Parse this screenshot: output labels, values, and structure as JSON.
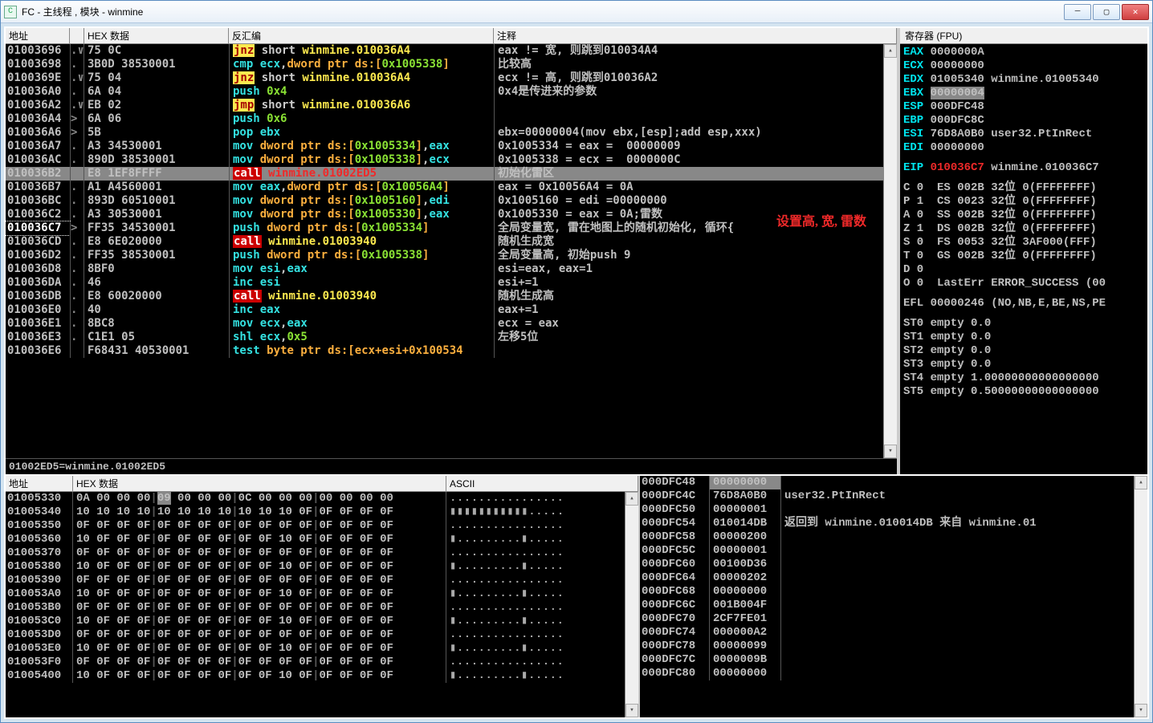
{
  "window": {
    "title": "FC - 主线程 , 模块 - winmine",
    "icon_letter": "C"
  },
  "disasm_headers": {
    "addr": "地址",
    "hex": "HEX 数据",
    "dis": "反汇编",
    "cmt": "注释"
  },
  "info_line": "01002ED5=winmine.01002ED5",
  "disasm": [
    {
      "addr": "01003696",
      "pre": ".∨",
      "hex": "75 0C",
      "m": "jnz",
      "mc": "jmp",
      "ops": [
        {
          "t": " short "
        },
        {
          "t": "winmine.010036A4",
          "c": "tgt"
        }
      ],
      "cmt": "eax != 宽, 则跳到010034A4"
    },
    {
      "addr": "01003698",
      "pre": ".",
      "hex": "3B0D 38530001",
      "m": "cmp",
      "mc": "",
      "ops": [
        {
          "t": " "
        },
        {
          "t": "ecx",
          "c": "reg"
        },
        {
          "t": ","
        },
        {
          "t": "dword ptr ds:[",
          "c": "mem"
        },
        {
          "t": "0x1005338",
          "c": "num"
        },
        {
          "t": "]",
          "c": "mem"
        }
      ],
      "cmt": "比较高"
    },
    {
      "addr": "0100369E",
      "pre": ".∨",
      "hex": "75 04",
      "m": "jnz",
      "mc": "jmp",
      "ops": [
        {
          "t": " short "
        },
        {
          "t": "winmine.010036A4",
          "c": "tgt"
        }
      ],
      "cmt": "ecx != 高, 则跳到010036A2"
    },
    {
      "addr": "010036A0",
      "pre": ".",
      "hex": "6A 04",
      "m": "push",
      "mc": "",
      "ops": [
        {
          "t": " "
        },
        {
          "t": "0x4",
          "c": "num"
        }
      ],
      "cmt": "0x4是传进来的参数"
    },
    {
      "addr": "010036A2",
      "pre": ".∨",
      "hex": "EB 02",
      "m": "jmp",
      "mc": "jmp",
      "ops": [
        {
          "t": " short "
        },
        {
          "t": "winmine.010036A6",
          "c": "tgt"
        }
      ],
      "cmt": ""
    },
    {
      "addr": "010036A4",
      "pre": ">",
      "hex": "6A 06",
      "m": "push",
      "mc": "",
      "ops": [
        {
          "t": " "
        },
        {
          "t": "0x6",
          "c": "num"
        }
      ],
      "cmt": ""
    },
    {
      "addr": "010036A6",
      "pre": ">",
      "hex": "5B",
      "m": "pop",
      "mc": "",
      "ops": [
        {
          "t": " "
        },
        {
          "t": "ebx",
          "c": "reg"
        }
      ],
      "cmt": "ebx=00000004(mov ebx,[esp];add esp,xxx)"
    },
    {
      "addr": "010036A7",
      "pre": ".",
      "hex": "A3 34530001",
      "m": "mov",
      "mc": "",
      "ops": [
        {
          "t": " "
        },
        {
          "t": "dword ptr ds:[",
          "c": "mem"
        },
        {
          "t": "0x1005334",
          "c": "num"
        },
        {
          "t": "]",
          "c": "mem"
        },
        {
          "t": ","
        },
        {
          "t": "eax",
          "c": "reg"
        }
      ],
      "cmt": "0x1005334 = eax =  00000009"
    },
    {
      "addr": "010036AC",
      "pre": ".",
      "hex": "890D 38530001",
      "m": "mov",
      "mc": "",
      "ops": [
        {
          "t": " "
        },
        {
          "t": "dword ptr ds:[",
          "c": "mem"
        },
        {
          "t": "0x1005338",
          "c": "num"
        },
        {
          "t": "]",
          "c": "mem"
        },
        {
          "t": ","
        },
        {
          "t": "ecx",
          "c": "reg"
        }
      ],
      "cmt": "0x1005338 = ecx =  0000000C"
    },
    {
      "addr": "010036B2",
      "pre": ".",
      "hex": "E8 1EF8FFFF",
      "m": "call",
      "mc": "call",
      "ops": [
        {
          "t": " "
        },
        {
          "t": "winmine.01002ED5",
          "c": "hi"
        }
      ],
      "cmt": "初始化雷区",
      "sel": true
    },
    {
      "addr": "010036B7",
      "pre": ".",
      "hex": "A1 A4560001",
      "m": "mov",
      "mc": "",
      "ops": [
        {
          "t": " "
        },
        {
          "t": "eax",
          "c": "reg"
        },
        {
          "t": ","
        },
        {
          "t": "dword ptr ds:[",
          "c": "mem"
        },
        {
          "t": "0x10056A4",
          "c": "num"
        },
        {
          "t": "]",
          "c": "mem"
        }
      ],
      "cmt": "eax = 0x10056A4 = 0A"
    },
    {
      "addr": "010036BC",
      "pre": ".",
      "hex": "893D 60510001",
      "m": "mov",
      "mc": "",
      "ops": [
        {
          "t": " "
        },
        {
          "t": "dword ptr ds:[",
          "c": "mem"
        },
        {
          "t": "0x1005160",
          "c": "num"
        },
        {
          "t": "]",
          "c": "mem"
        },
        {
          "t": ","
        },
        {
          "t": "edi",
          "c": "reg"
        }
      ],
      "cmt": "0x1005160 = edi =00000000"
    },
    {
      "addr": "010036C2",
      "pre": ".",
      "hex": "A3 30530001",
      "m": "mov",
      "mc": "",
      "ops": [
        {
          "t": " "
        },
        {
          "t": "dword ptr ds:[",
          "c": "mem"
        },
        {
          "t": "0x1005330",
          "c": "num"
        },
        {
          "t": "]",
          "c": "mem"
        },
        {
          "t": ","
        },
        {
          "t": "eax",
          "c": "reg"
        }
      ],
      "cmt": "0x1005330 = eax = 0A;雷数"
    },
    {
      "addr": "010036C7",
      "pre": ">",
      "hex": "FF35 34530001",
      "m": "push",
      "mc": "",
      "ops": [
        {
          "t": " "
        },
        {
          "t": "dword ptr ds:[",
          "c": "mem"
        },
        {
          "t": "0x1005334",
          "c": "num"
        },
        {
          "t": "]",
          "c": "mem"
        }
      ],
      "cmt": "全局变量宽, 雷在地图上的随机初始化, 循环{",
      "eip": true
    },
    {
      "addr": "010036CD",
      "pre": ".",
      "hex": "E8 6E020000",
      "m": "call",
      "mc": "call",
      "ops": [
        {
          "t": " "
        },
        {
          "t": "winmine.01003940",
          "c": "tgt"
        }
      ],
      "cmt": "随机生成宽"
    },
    {
      "addr": "010036D2",
      "pre": ".",
      "hex": "FF35 38530001",
      "m": "push",
      "mc": "",
      "ops": [
        {
          "t": " "
        },
        {
          "t": "dword ptr ds:[",
          "c": "mem"
        },
        {
          "t": "0x1005338",
          "c": "num"
        },
        {
          "t": "]",
          "c": "mem"
        }
      ],
      "cmt": "全局变量高, 初始push 9"
    },
    {
      "addr": "010036D8",
      "pre": ".",
      "hex": "8BF0",
      "m": "mov",
      "mc": "",
      "ops": [
        {
          "t": " "
        },
        {
          "t": "esi",
          "c": "reg"
        },
        {
          "t": ","
        },
        {
          "t": "eax",
          "c": "reg"
        }
      ],
      "cmt": "esi=eax, eax=1"
    },
    {
      "addr": "010036DA",
      "pre": ".",
      "hex": "46",
      "m": "inc",
      "mc": "",
      "ops": [
        {
          "t": " "
        },
        {
          "t": "esi",
          "c": "reg"
        }
      ],
      "cmt": "esi+=1"
    },
    {
      "addr": "010036DB",
      "pre": ".",
      "hex": "E8 60020000",
      "m": "call",
      "mc": "call",
      "ops": [
        {
          "t": " "
        },
        {
          "t": "winmine.01003940",
          "c": "tgt"
        }
      ],
      "cmt": "随机生成高"
    },
    {
      "addr": "010036E0",
      "pre": ".",
      "hex": "40",
      "m": "inc",
      "mc": "",
      "ops": [
        {
          "t": " "
        },
        {
          "t": "eax",
          "c": "reg"
        }
      ],
      "cmt": "eax+=1"
    },
    {
      "addr": "010036E1",
      "pre": ".",
      "hex": "8BC8",
      "m": "mov",
      "mc": "",
      "ops": [
        {
          "t": " "
        },
        {
          "t": "ecx",
          "c": "reg"
        },
        {
          "t": ","
        },
        {
          "t": "eax",
          "c": "reg"
        }
      ],
      "cmt": "ecx = eax"
    },
    {
      "addr": "010036E3",
      "pre": ".",
      "hex": "C1E1 05",
      "m": "shl",
      "mc": "",
      "ops": [
        {
          "t": " "
        },
        {
          "t": "ecx",
          "c": "reg"
        },
        {
          "t": ","
        },
        {
          "t": "0x5",
          "c": "num"
        }
      ],
      "cmt": "左移5位"
    },
    {
      "addr": "010036E6",
      "pre": "",
      "hex": "F68431 40530001",
      "m": "test",
      "mc": "",
      "ops": [
        {
          "t": " "
        },
        {
          "t": "byte ptr ds:[ecx+esi+0x100534",
          "c": "mem"
        }
      ],
      "cmt": ""
    }
  ],
  "registers": {
    "title": "寄存器 (FPU)",
    "main": [
      {
        "n": "EAX",
        "v": "0000000A"
      },
      {
        "n": "ECX",
        "v": "00000000"
      },
      {
        "n": "EDX",
        "v": "01005340",
        "ex": "winmine.01005340"
      },
      {
        "n": "EBX",
        "v": "00000004",
        "hl": true
      },
      {
        "n": "ESP",
        "v": "000DFC48"
      },
      {
        "n": "EBP",
        "v": "000DFC8C"
      },
      {
        "n": "ESI",
        "v": "76D8A0B0",
        "ex": "user32.PtInRect"
      },
      {
        "n": "EDI",
        "v": "00000000"
      }
    ],
    "eip": {
      "n": "EIP",
      "v": "010036C7",
      "ex": "winmine.010036C7"
    },
    "flags": [
      "C 0  ES 002B 32位 0(FFFFFFFF)",
      "P 1  CS 0023 32位 0(FFFFFFFF)",
      "A 0  SS 002B 32位 0(FFFFFFFF)",
      "Z 1  DS 002B 32位 0(FFFFFFFF)",
      "S 0  FS 0053 32位 3AF000(FFF)",
      "T 0  GS 002B 32位 0(FFFFFFFF)",
      "D 0",
      "O 0  LastErr ERROR_SUCCESS (00"
    ],
    "efl": "EFL 00000246 (NO,NB,E,BE,NS,PE",
    "fpu": [
      "ST0 empty 0.0",
      "ST1 empty 0.0",
      "ST2 empty 0.0",
      "ST3 empty 0.0",
      "ST4 empty 1.00000000000000000",
      "ST5 empty 0.50000000000000000"
    ]
  },
  "dump_headers": {
    "addr": "地址",
    "hex": "HEX 数据",
    "ascii": "ASCII"
  },
  "dump": [
    {
      "a": "01005330",
      "h": "0A 00 00 00|09 00 00 00|0C 00 00 00|00 00 00 00",
      "asc": "................",
      "hlpos": 4
    },
    {
      "a": "01005340",
      "h": "10 10 10 10|10 10 10 10|10 10 10 0F|0F 0F 0F 0F",
      "asc": "▮▮▮▮▮▮▮▮▮▮▮....."
    },
    {
      "a": "01005350",
      "h": "0F 0F 0F 0F|0F 0F 0F 0F|0F 0F 0F 0F|0F 0F 0F 0F",
      "asc": "................"
    },
    {
      "a": "01005360",
      "h": "10 0F 0F 0F|0F 0F 0F 0F|0F 0F 10 0F|0F 0F 0F 0F",
      "asc": "▮.........▮....."
    },
    {
      "a": "01005370",
      "h": "0F 0F 0F 0F|0F 0F 0F 0F|0F 0F 0F 0F|0F 0F 0F 0F",
      "asc": "................"
    },
    {
      "a": "01005380",
      "h": "10 0F 0F 0F|0F 0F 0F 0F|0F 0F 10 0F|0F 0F 0F 0F",
      "asc": "▮.........▮....."
    },
    {
      "a": "01005390",
      "h": "0F 0F 0F 0F|0F 0F 0F 0F|0F 0F 0F 0F|0F 0F 0F 0F",
      "asc": "................"
    },
    {
      "a": "010053A0",
      "h": "10 0F 0F 0F|0F 0F 0F 0F|0F 0F 10 0F|0F 0F 0F 0F",
      "asc": "▮.........▮....."
    },
    {
      "a": "010053B0",
      "h": "0F 0F 0F 0F|0F 0F 0F 0F|0F 0F 0F 0F|0F 0F 0F 0F",
      "asc": "................"
    },
    {
      "a": "010053C0",
      "h": "10 0F 0F 0F|0F 0F 0F 0F|0F 0F 10 0F|0F 0F 0F 0F",
      "asc": "▮.........▮....."
    },
    {
      "a": "010053D0",
      "h": "0F 0F 0F 0F|0F 0F 0F 0F|0F 0F 0F 0F|0F 0F 0F 0F",
      "asc": "................"
    },
    {
      "a": "010053E0",
      "h": "10 0F 0F 0F|0F 0F 0F 0F|0F 0F 10 0F|0F 0F 0F 0F",
      "asc": "▮.........▮....."
    },
    {
      "a": "010053F0",
      "h": "0F 0F 0F 0F|0F 0F 0F 0F|0F 0F 0F 0F|0F 0F 0F 0F",
      "asc": "................"
    },
    {
      "a": "01005400",
      "h": "10 0F 0F 0F|0F 0F 0F 0F|0F 0F 10 0F|0F 0F 0F 0F",
      "asc": "▮.........▮....."
    }
  ],
  "stack": [
    {
      "a": "000DFC48",
      "v": "00000000",
      "top": true
    },
    {
      "a": "000DFC4C",
      "v": "76D8A0B0",
      "c": "user32.PtInRect"
    },
    {
      "a": "000DFC50",
      "v": "00000001"
    },
    {
      "a": "000DFC54",
      "v": "010014DB",
      "c": "返回到 winmine.010014DB 来自 winmine.01"
    },
    {
      "a": "000DFC58",
      "v": "00000200"
    },
    {
      "a": "000DFC5C",
      "v": "00000001"
    },
    {
      "a": "000DFC60",
      "v": "00100D36"
    },
    {
      "a": "000DFC64",
      "v": "00000202"
    },
    {
      "a": "000DFC68",
      "v": "00000000"
    },
    {
      "a": "000DFC6C",
      "v": "001B004F"
    },
    {
      "a": "000DFC70",
      "v": "2CF7FE01"
    },
    {
      "a": "000DFC74",
      "v": "000000A2"
    },
    {
      "a": "000DFC78",
      "v": "00000099"
    },
    {
      "a": "000DFC7C",
      "v": "0000009B"
    },
    {
      "a": "000DFC80",
      "v": "00000000"
    }
  ],
  "annotation": "设置高, 宽, 雷数"
}
